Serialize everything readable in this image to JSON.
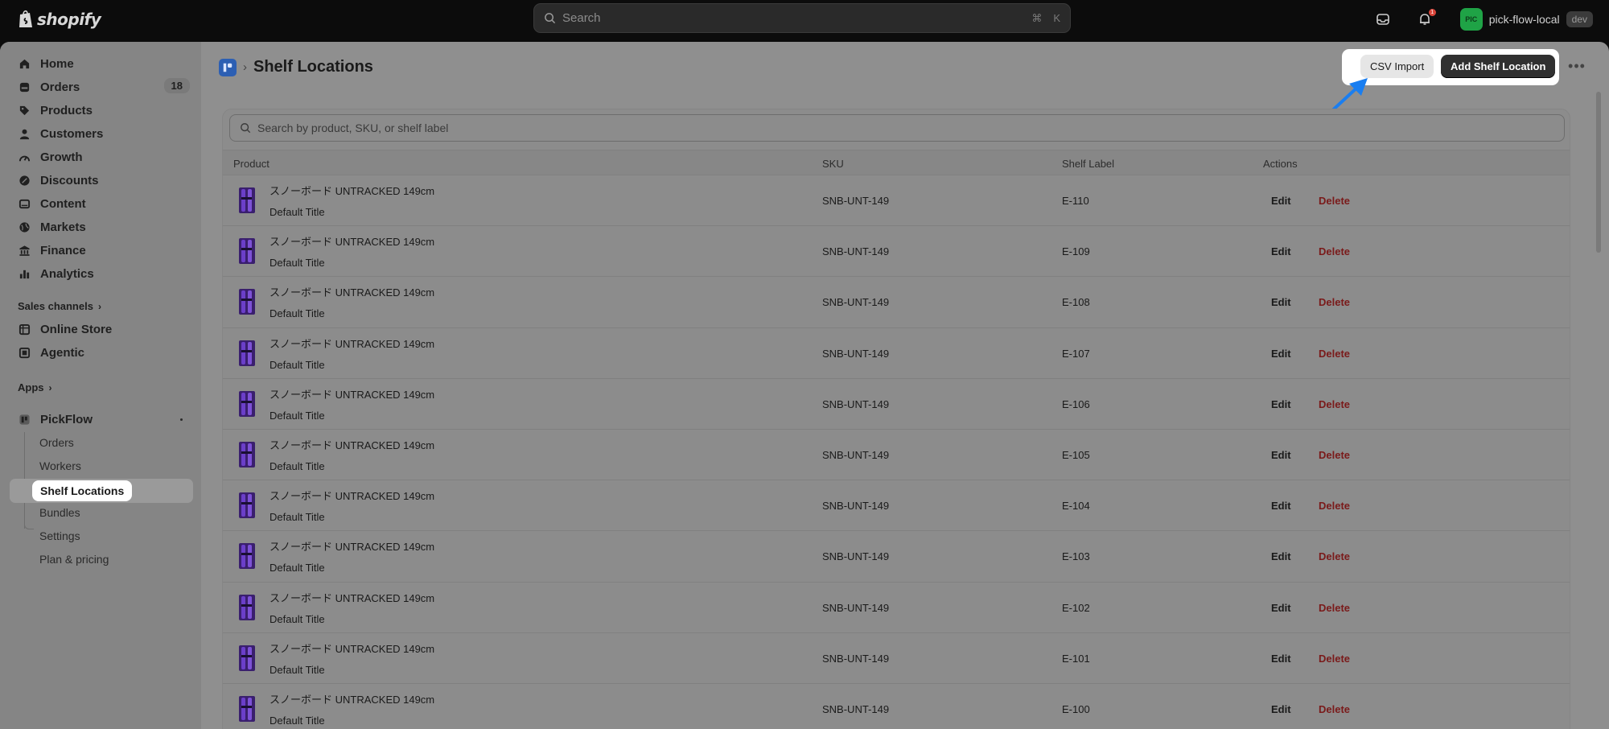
{
  "topbar": {
    "brand": "shopify",
    "search_placeholder": "Search",
    "shortcut_cmd": "⌘",
    "shortcut_key": "K",
    "notification_count": "1",
    "avatar_initials": "PIC",
    "store_name": "pick-flow-local",
    "env_badge": "dev"
  },
  "sidebar": {
    "items": [
      {
        "label": "Home",
        "icon": "home-icon"
      },
      {
        "label": "Orders",
        "icon": "orders-icon",
        "count": "18"
      },
      {
        "label": "Products",
        "icon": "tag-icon"
      },
      {
        "label": "Customers",
        "icon": "person-icon"
      },
      {
        "label": "Growth",
        "icon": "growth-icon"
      },
      {
        "label": "Discounts",
        "icon": "discount-icon"
      },
      {
        "label": "Content",
        "icon": "content-icon"
      },
      {
        "label": "Markets",
        "icon": "globe-icon"
      },
      {
        "label": "Finance",
        "icon": "bank-icon"
      },
      {
        "label": "Analytics",
        "icon": "bar-chart-icon"
      }
    ],
    "sales_channels_label": "Sales channels",
    "channels": [
      {
        "label": "Online Store",
        "icon": "store-icon"
      },
      {
        "label": "Agentic",
        "icon": "agentic-icon"
      }
    ],
    "apps_label": "Apps",
    "app": {
      "label": "PickFlow",
      "sub_items": [
        "Orders",
        "Workers",
        "Shelf Locations",
        "Bundles",
        "Settings",
        "Plan & pricing"
      ],
      "active": "Shelf Locations"
    }
  },
  "page": {
    "title": "Shelf Locations",
    "csv_import_label": "CSV Import",
    "add_label": "Add Shelf Location",
    "more_label": "•••",
    "search_placeholder": "Search by product, SKU, or shelf label"
  },
  "table": {
    "columns": [
      "Product",
      "SKU",
      "Shelf Label",
      "Actions"
    ],
    "edit_label": "Edit",
    "delete_label": "Delete",
    "rows": [
      {
        "product": "スノーボード UNTRACKED 149cm",
        "variant": "Default Title",
        "sku": "SNB-UNT-149",
        "shelf": "E-110"
      },
      {
        "product": "スノーボード UNTRACKED 149cm",
        "variant": "Default Title",
        "sku": "SNB-UNT-149",
        "shelf": "E-109"
      },
      {
        "product": "スノーボード UNTRACKED 149cm",
        "variant": "Default Title",
        "sku": "SNB-UNT-149",
        "shelf": "E-108"
      },
      {
        "product": "スノーボード UNTRACKED 149cm",
        "variant": "Default Title",
        "sku": "SNB-UNT-149",
        "shelf": "E-107"
      },
      {
        "product": "スノーボード UNTRACKED 149cm",
        "variant": "Default Title",
        "sku": "SNB-UNT-149",
        "shelf": "E-106"
      },
      {
        "product": "スノーボード UNTRACKED 149cm",
        "variant": "Default Title",
        "sku": "SNB-UNT-149",
        "shelf": "E-105"
      },
      {
        "product": "スノーボード UNTRACKED 149cm",
        "variant": "Default Title",
        "sku": "SNB-UNT-149",
        "shelf": "E-104"
      },
      {
        "product": "スノーボード UNTRACKED 149cm",
        "variant": "Default Title",
        "sku": "SNB-UNT-149",
        "shelf": "E-103"
      },
      {
        "product": "スノーボード UNTRACKED 149cm",
        "variant": "Default Title",
        "sku": "SNB-UNT-149",
        "shelf": "E-102"
      },
      {
        "product": "スノーボード UNTRACKED 149cm",
        "variant": "Default Title",
        "sku": "SNB-UNT-149",
        "shelf": "E-101"
      },
      {
        "product": "スノーボード UNTRACKED 149cm",
        "variant": "Default Title",
        "sku": "SNB-UNT-149",
        "shelf": "E-100"
      }
    ]
  },
  "colors": {
    "accent_arrow": "#1a7ef0",
    "delete_text": "#7a1a1a",
    "primary_button": "#303030",
    "avatar_bg": "#1fa346"
  }
}
